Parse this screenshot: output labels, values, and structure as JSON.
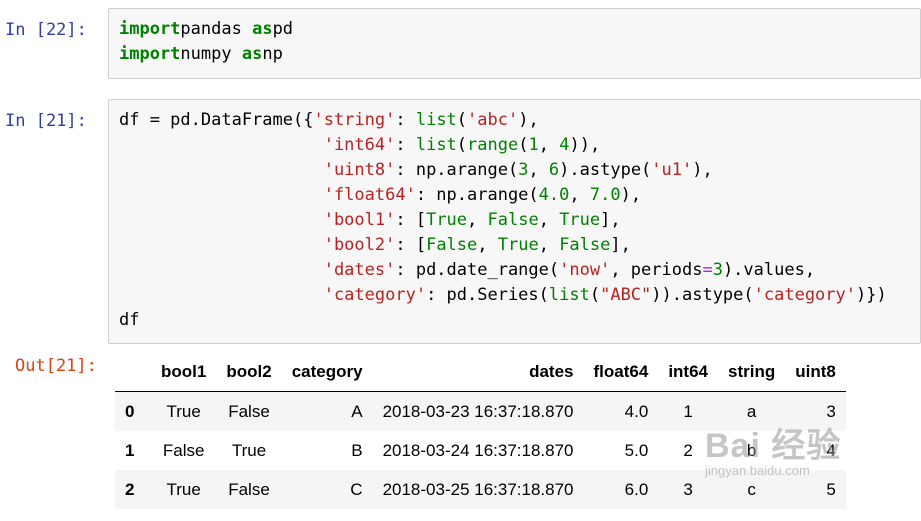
{
  "cells": [
    {
      "prompt": "In  [22]:",
      "lines": [
        [
          [
            "kw",
            "import"
          ],
          [
            "",
            "pandas "
          ],
          [
            "kw",
            "as"
          ],
          [
            "",
            "pd"
          ]
        ],
        [
          [
            "kw",
            "import"
          ],
          [
            "",
            "numpy "
          ],
          [
            "kw",
            "as"
          ],
          [
            "",
            "np"
          ]
        ]
      ]
    },
    {
      "prompt": "In  [21]:",
      "lines": [
        [
          [
            "",
            "df = pd.DataFrame({"
          ],
          [
            "str",
            "'string'"
          ],
          [
            "",
            ": "
          ],
          [
            "bi",
            "list"
          ],
          [
            "",
            "("
          ],
          [
            "str",
            "'abc'"
          ],
          [
            "",
            "),"
          ]
        ],
        [
          [
            "",
            "                    "
          ],
          [
            "str",
            "'int64'"
          ],
          [
            "",
            ": "
          ],
          [
            "bi",
            "list"
          ],
          [
            "",
            "("
          ],
          [
            "bi",
            "range"
          ],
          [
            "",
            "("
          ],
          [
            "num",
            "1"
          ],
          [
            "",
            ", "
          ],
          [
            "num",
            "4"
          ],
          [
            "",
            ")),"
          ]
        ],
        [
          [
            "",
            "                    "
          ],
          [
            "str",
            "'uint8'"
          ],
          [
            "",
            ": np.arange("
          ],
          [
            "num",
            "3"
          ],
          [
            "",
            ", "
          ],
          [
            "num",
            "6"
          ],
          [
            "",
            ").astype("
          ],
          [
            "str",
            "'u1'"
          ],
          [
            "",
            "),"
          ]
        ],
        [
          [
            "",
            "                    "
          ],
          [
            "str",
            "'float64'"
          ],
          [
            "",
            ": np.arange("
          ],
          [
            "num",
            "4.0"
          ],
          [
            "",
            ", "
          ],
          [
            "num",
            "7.0"
          ],
          [
            "",
            "),"
          ]
        ],
        [
          [
            "",
            "                    "
          ],
          [
            "str",
            "'bool1'"
          ],
          [
            "",
            ": ["
          ],
          [
            "bi",
            "True"
          ],
          [
            "",
            ", "
          ],
          [
            "bi",
            "False"
          ],
          [
            "",
            ", "
          ],
          [
            "bi",
            "True"
          ],
          [
            "",
            "],"
          ]
        ],
        [
          [
            "",
            "                    "
          ],
          [
            "str",
            "'bool2'"
          ],
          [
            "",
            ": ["
          ],
          [
            "bi",
            "False"
          ],
          [
            "",
            ", "
          ],
          [
            "bi",
            "True"
          ],
          [
            "",
            ", "
          ],
          [
            "bi",
            "False"
          ],
          [
            "",
            "],"
          ]
        ],
        [
          [
            "",
            "                    "
          ],
          [
            "str",
            "'dates'"
          ],
          [
            "",
            ": pd.date_range("
          ],
          [
            "str",
            "'now'"
          ],
          [
            "",
            ", periods"
          ],
          [
            "op",
            "="
          ],
          [
            "num",
            "3"
          ],
          [
            "",
            ").values,"
          ]
        ],
        [
          [
            "",
            "                    "
          ],
          [
            "str",
            "'category'"
          ],
          [
            "",
            ": pd.Series("
          ],
          [
            "bi",
            "list"
          ],
          [
            "",
            "("
          ],
          [
            "str",
            "\"ABC\""
          ],
          [
            "",
            ")).astype("
          ],
          [
            "str",
            "'category'"
          ],
          [
            "",
            ")})"
          ]
        ],
        [
          [
            "",
            "df"
          ]
        ]
      ]
    }
  ],
  "output": {
    "prompt": "Out[21]:",
    "columns": [
      "bool1",
      "bool2",
      "category",
      "dates",
      "float64",
      "int64",
      "string",
      "uint8"
    ],
    "rows": [
      {
        "index": "0",
        "values": [
          "True",
          "False",
          "A",
          "2018-03-23 16:37:18.870",
          "4.0",
          "1",
          "a",
          "3"
        ]
      },
      {
        "index": "1",
        "values": [
          "False",
          "True",
          "B",
          "2018-03-24 16:37:18.870",
          "5.0",
          "2",
          "b",
          "4"
        ]
      },
      {
        "index": "2",
        "values": [
          "True",
          "False",
          "C",
          "2018-03-25 16:37:18.870",
          "6.0",
          "3",
          "c",
          "5"
        ]
      }
    ]
  },
  "watermark": {
    "main": "Bai 经验",
    "sub": "jingyan.baidu.com"
  }
}
